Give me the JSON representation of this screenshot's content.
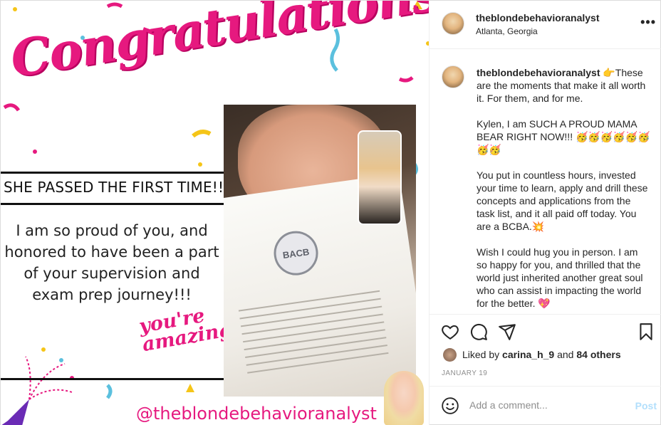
{
  "post": {
    "image_text": {
      "congratulations": "Congratulations",
      "passed": "SHE PASSED THE FIRST TIME!!!!",
      "proud": "I am so proud of you, and honored to have been a part of your supervision and exam prep journey!!!",
      "amazing": "you're amazing",
      "handle": "@theblondebehavioranalyst",
      "seal": "BACB"
    }
  },
  "header": {
    "username": "theblondebehavioranalyst",
    "location": "Atlanta, Georgia",
    "more_icon": "more-options-icon"
  },
  "caption": {
    "username": "theblondebehavioranalyst",
    "text": "👉These are the moments that make it all worth it. For them, and for me.\n\nKylen, I am SUCH A PROUD MAMA BEAR RIGHT NOW!!! 🥳🥳🥳🥳🥳🥳🥳🥳\n\nYou put in countless hours, invested your time to learn, apply and drill these concepts and applications from the task list, and it all paid off today. You are a BCBA.💥\n\nWish I could hug you in person. I am so happy for you, and thrilled that the world just inherited another great soul who can assist in impacting the world for the better. 💖"
  },
  "actions": {
    "like_icon": "heart-icon",
    "comment_icon": "comment-icon",
    "share_icon": "share-icon",
    "save_icon": "bookmark-icon"
  },
  "likes": {
    "prefix": "Liked by ",
    "user": "carina_h_9",
    "middle": " and ",
    "count": "84 others"
  },
  "date": "JANUARY 19",
  "comment": {
    "placeholder": "Add a comment...",
    "post_label": "Post",
    "emoji_icon": "smiley-icon"
  },
  "colors": {
    "accent_pink": "#e6197f",
    "post_disabled": "#b2dffc",
    "text": "#262626",
    "muted": "#8e8e8e"
  }
}
